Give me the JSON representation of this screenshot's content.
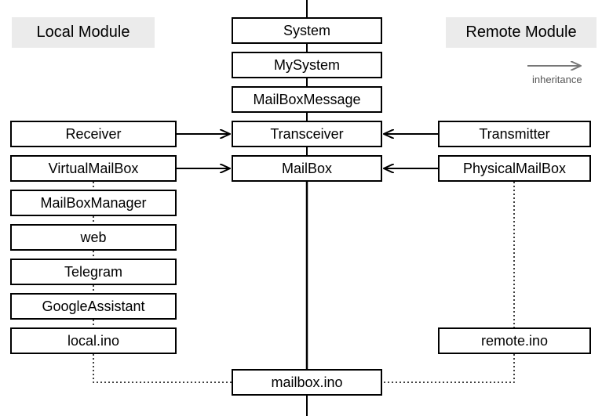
{
  "headers": {
    "local": "Local Module",
    "remote": "Remote Module"
  },
  "legend": {
    "label": "inheritance"
  },
  "center": {
    "system": "System",
    "mysystem": "MySystem",
    "mailboxmessage": "MailBoxMessage",
    "transceiver": "Transceiver",
    "mailbox": "MailBox",
    "mailboxino": "mailbox.ino"
  },
  "left": {
    "receiver": "Receiver",
    "virtualmailbox": "VirtualMailBox",
    "mailboxmanager": "MailBoxManager",
    "web": "web",
    "telegram": "Telegram",
    "googleassistant": "GoogleAssistant",
    "localino": "local.ino"
  },
  "right": {
    "transmitter": "Transmitter",
    "physicalmailbox": "PhysicalMailBox",
    "remoteino": "remote.ino"
  }
}
